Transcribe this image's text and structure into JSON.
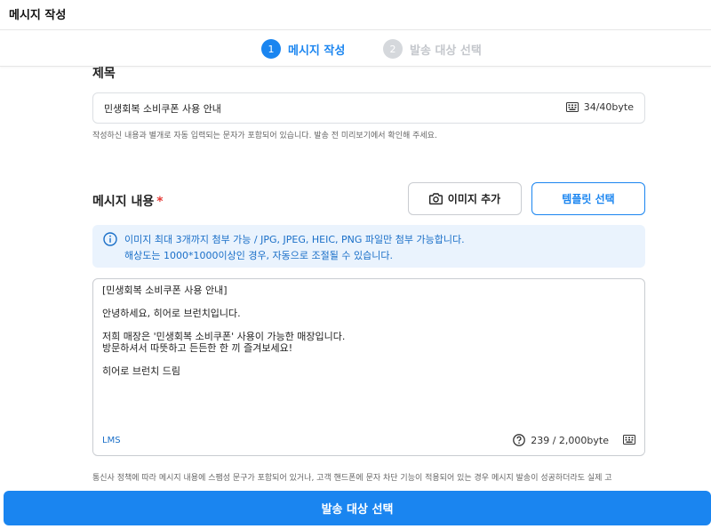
{
  "header": {
    "title": "메시지 작성"
  },
  "stepper": {
    "steps": [
      {
        "number": "1",
        "label": "메시지 작성",
        "active": true
      },
      {
        "number": "2",
        "label": "발송 대상 선택",
        "active": false
      }
    ]
  },
  "title_section": {
    "label": "제목",
    "value": "민생회복 소비쿠폰 사용 안내",
    "byte_counter": "34/40byte",
    "counter_icon": "keyboard-icon",
    "helper": "작성하신 내용과 별개로 자동 입력되는 문자가 포함되어 있습니다. 발송 전 미리보기에서 확인해 주세요."
  },
  "message_section": {
    "label": "메시지 내용",
    "required_mark": "*",
    "add_image_label": "이미지 추가",
    "template_label": "템플릿 선택",
    "info_lines": [
      "이미지 최대 3개까지 첨부 가능 / JPG, JPEG, HEIC, PNG 파일만 첨부 가능합니다.",
      "해상도는 1000*1000이상인 경우, 자동으로 조절될 수 있습니다."
    ],
    "body": "[민생회복 소비쿠폰 사용 안내]\n\n안녕하세요, 히어로 브런치입니다.\n\n저희 매장은 '민생회복 소비쿠폰' 사용이 가능한 매장입니다.\n방문하셔서 따뜻하고 든든한 한 끼 즐겨보세요!\n\n히어로 브런치 드림",
    "message_type": "LMS",
    "byte_counter": "239 / 2,000byte",
    "notice": "통신사 정책에 따라 메시지 내용에 스팸성 문구가 포함되어 있거나, 고객 핸드폰에 문자 차단 기능이 적용되어 있는 경우 메시지 발송이 성공하더라도 실제 고"
  },
  "footer": {
    "submit_label": "발송 대상 선택"
  },
  "colors": {
    "primary": "#1a85f0",
    "info_bg": "#eaf3fd",
    "required": "#e53935"
  }
}
